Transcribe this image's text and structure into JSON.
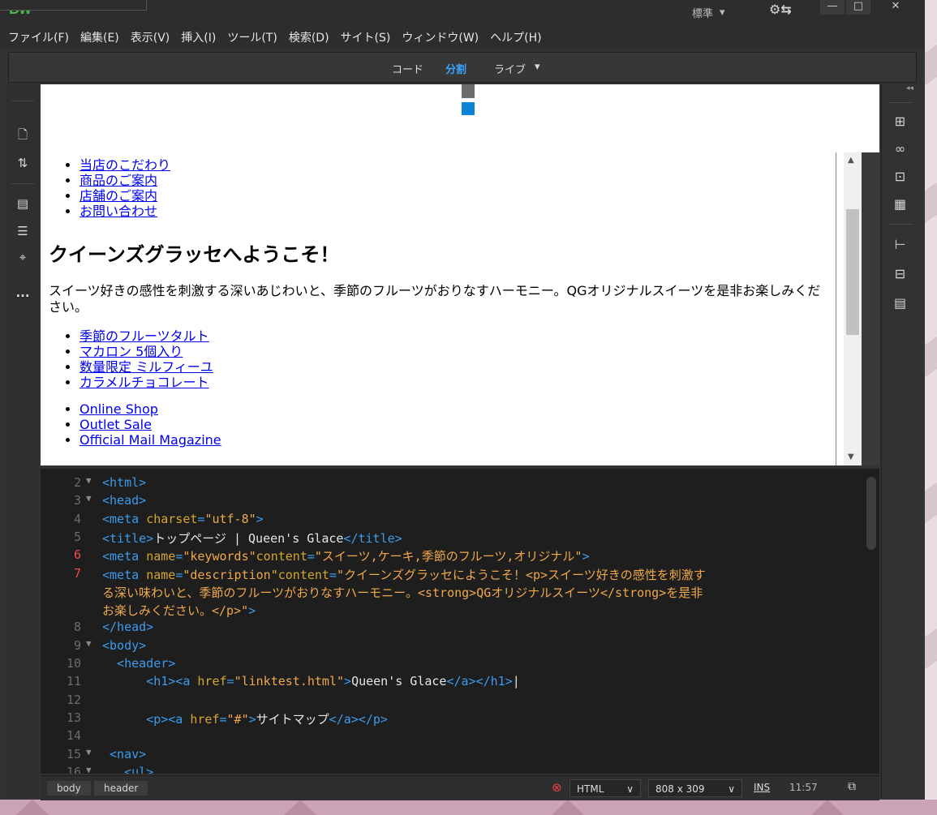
{
  "app": {
    "logo": "Dw"
  },
  "title_bar": {
    "workspace": "標準",
    "workspace_arrow": "▾",
    "sync_icon": "⚙⇆",
    "minimize": "—",
    "maximize": "□",
    "close": "✕"
  },
  "menu": [
    "ファイル(F)",
    "編集(E)",
    "表示(V)",
    "挿入(I)",
    "ツール(T)",
    "検索(D)",
    "サイト(S)",
    "ウィンドウ(W)",
    "ヘルプ(H)"
  ],
  "view_switch": {
    "code": "コード",
    "split": "分割",
    "live": "ライブ",
    "live_arrow": "▾"
  },
  "left_toolbar": [
    "file-icon",
    "sort-icon",
    "inspect-icon",
    "format-icon",
    "target-icon",
    "more-icon"
  ],
  "right_panel": [
    "sitemap-icon",
    "creative-cloud-icon",
    "insert-panel-icon",
    "css-designer-icon",
    "dom-icon",
    "assets-icon",
    "snippets-icon"
  ],
  "live_view": {
    "nav_links": [
      "当店のこだわり",
      "商品のご案内",
      "店舗のご案内",
      "お問い合わせ"
    ],
    "heading": "クイーンズグラッセへようこそ！",
    "paragraph": "スイーツ好きの感性を刺激する深いあじわいと、季節のフルーツがおりなすハーモニー。QGオリジナルスイーツを是非お楽しみください。",
    "product_links": [
      "季節のフルーツタルト",
      "マカロン 5個入り",
      "数量限定 ミルフィーユ",
      "カラメルチョコレート"
    ],
    "shop_links": [
      "Online Shop",
      "Outlet Sale",
      "Official Mail Magazine"
    ]
  },
  "code_view": {
    "lines": [
      {
        "num": "2",
        "fold": "▼",
        "err": false,
        "parts": [
          [
            "tag",
            "<html>"
          ]
        ]
      },
      {
        "num": "3",
        "fold": "▼",
        "err": false,
        "parts": [
          [
            "tag",
            "<head>"
          ]
        ]
      },
      {
        "num": "4",
        "fold": "",
        "err": false,
        "parts": [
          [
            "tag",
            "<meta "
          ],
          [
            "attr",
            "charset"
          ],
          [
            "tag",
            "="
          ],
          [
            "str",
            "\"utf-8\""
          ],
          [
            "tag",
            ">"
          ]
        ]
      },
      {
        "num": "5",
        "fold": "",
        "err": false,
        "parts": [
          [
            "tag",
            "<title>"
          ],
          [
            "txt",
            "トップページ | Queen's Glace"
          ],
          [
            "tag",
            "</title>"
          ]
        ]
      },
      {
        "num": "6",
        "fold": "",
        "err": true,
        "parts": [
          [
            "tag",
            "<meta "
          ],
          [
            "attr",
            "name"
          ],
          [
            "tag",
            "="
          ],
          [
            "str",
            "\"keywords\""
          ],
          [
            "attr",
            "content"
          ],
          [
            "tag",
            "="
          ],
          [
            "str",
            "\"スイーツ,ケーキ,季節のフルーツ,オリジナル\""
          ],
          [
            "tag",
            ">"
          ]
        ]
      },
      {
        "num": "7",
        "fold": "",
        "err": true,
        "parts": [
          [
            "tag",
            "<meta "
          ],
          [
            "attr",
            "name"
          ],
          [
            "tag",
            "="
          ],
          [
            "str",
            "\"description\""
          ],
          [
            "attr",
            "content"
          ],
          [
            "tag",
            "="
          ],
          [
            "str",
            "\"クイーンズグラッセにようこそ！<p>スイーツ好きの感性を刺激す"
          ]
        ]
      },
      {
        "num": "",
        "fold": "",
        "err": false,
        "parts": [
          [
            "str",
            "る深い味わいと、季節のフルーツがおりなすハーモニー。<strong>QGオリジナルスイーツ</strong>を是非"
          ]
        ]
      },
      {
        "num": "",
        "fold": "",
        "err": false,
        "parts": [
          [
            "str",
            "お楽しみください。</p>\""
          ],
          [
            "tag",
            ">"
          ]
        ]
      },
      {
        "num": "8",
        "fold": "",
        "err": false,
        "parts": [
          [
            "tag",
            "</head>"
          ]
        ]
      },
      {
        "num": "9",
        "fold": "▼",
        "err": false,
        "parts": [
          [
            "tag",
            "<body>"
          ]
        ]
      },
      {
        "num": "10",
        "fold": "",
        "err": false,
        "parts": [
          [
            "tag",
            "  <header>"
          ]
        ]
      },
      {
        "num": "11",
        "fold": "",
        "err": false,
        "parts": [
          [
            "tag",
            "      <h1><a "
          ],
          [
            "attr",
            "href"
          ],
          [
            "tag",
            "="
          ],
          [
            "str",
            "\"linktest.html\""
          ],
          [
            "tag",
            ">"
          ],
          [
            "txt",
            "Queen's Glace"
          ],
          [
            "tag",
            "</a></h1>"
          ],
          [
            "txt",
            "|"
          ]
        ]
      },
      {
        "num": "12",
        "fold": "",
        "err": false,
        "parts": []
      },
      {
        "num": "13",
        "fold": "",
        "err": false,
        "parts": [
          [
            "tag",
            "      <p><a "
          ],
          [
            "attr",
            "href"
          ],
          [
            "tag",
            "="
          ],
          [
            "str",
            "\"#\""
          ],
          [
            "tag",
            ">"
          ],
          [
            "txt",
            "サイトマップ"
          ],
          [
            "tag",
            "</a></p>"
          ]
        ]
      },
      {
        "num": "14",
        "fold": "",
        "err": false,
        "parts": []
      },
      {
        "num": "15",
        "fold": "▼",
        "err": false,
        "parts": [
          [
            "tag",
            " <nav>"
          ]
        ]
      },
      {
        "num": "16",
        "fold": "▼",
        "err": false,
        "parts": [
          [
            "tag",
            "   <ul>"
          ]
        ]
      }
    ]
  },
  "status_bar": {
    "crumbs": [
      "body",
      "header"
    ],
    "error_icon": "⊗",
    "language": "HTML",
    "language_arrow": "∨",
    "size": "808 x 309",
    "size_arrow": "∨",
    "mode": "INS",
    "position": "11:57",
    "preview_icon": "⧉"
  }
}
